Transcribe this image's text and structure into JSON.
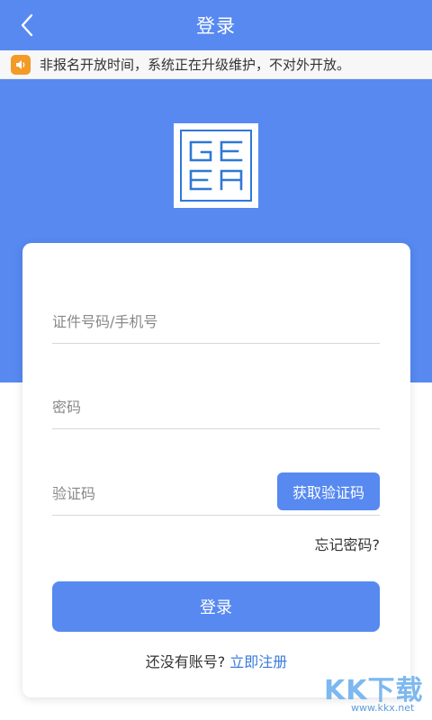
{
  "nav": {
    "title": "登录",
    "back_icon": "chevron-left-icon"
  },
  "notice": {
    "icon": "speaker-icon",
    "text": "非报名开放时间，系统正在升级维护，不对外开放。"
  },
  "logo": {
    "text": "GEEA"
  },
  "form": {
    "id_placeholder": "证件号码/手机号",
    "password_placeholder": "密码",
    "code_placeholder": "验证码",
    "get_code_label": "获取验证码",
    "forgot_label": "忘记密码?",
    "login_label": "登录",
    "no_account_text": "还没有账号?",
    "register_label": "立即注册"
  },
  "watermark": {
    "title": "KK下载",
    "url": "www.kkx.net"
  },
  "colors": {
    "primary": "#5789f1",
    "link": "#3a7bdc",
    "notice_icon": "#f39a27"
  }
}
